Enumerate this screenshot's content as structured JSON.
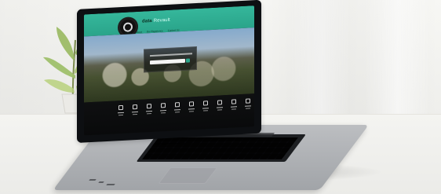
{
  "site": {
    "brand_main": "data",
    "brand_sub": "Revault",
    "menu": [
      "Home",
      "About",
      "Our Experience",
      "Contact Us"
    ],
    "search_placeholder": "",
    "colors": {
      "accent": "#2aa48a",
      "header": "#35b79b",
      "dark": "#0f1011"
    }
  },
  "scene": {
    "icons": [
      "plant-icon",
      "laptop-icon",
      "search-icon",
      "category-icon"
    ]
  }
}
